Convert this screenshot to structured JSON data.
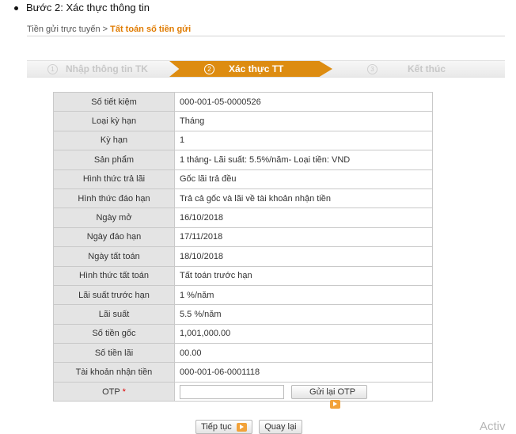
{
  "heading": {
    "step_text": "Bước 2: Xác thực  thông tin"
  },
  "breadcrumb": {
    "root": "Tiền gửi trực tuyến",
    "separator": " > ",
    "current": "Tất toán số tiền gửi"
  },
  "steps": [
    {
      "number": "1",
      "label": "Nhập thông tin TK",
      "state": "done"
    },
    {
      "number": "2",
      "label": "Xác thực TT",
      "state": "active"
    },
    {
      "number": "3",
      "label": "Kết thúc",
      "state": "pending"
    }
  ],
  "details": {
    "so_tiet_kiem": {
      "label": "Số tiết kiệm",
      "value": "000-001-05-0000526"
    },
    "loai_ky_han": {
      "label": "Loại kỳ hạn",
      "value": "Tháng"
    },
    "ky_han": {
      "label": "Kỳ hạn",
      "value": "1"
    },
    "san_pham": {
      "label": "Sản phẩm",
      "value": "1 tháng- Lãi suất: 5.5%/năm- Loại tiền: VND"
    },
    "hinh_thuc_tra_lai": {
      "label": "Hình thức trả lãi",
      "value": "Gốc lãi trả đều"
    },
    "hinh_thuc_dao_han": {
      "label": "Hình thức đáo hạn",
      "value": "Trả cả gốc và lãi về tài khoản nhận tiền"
    },
    "ngay_mo": {
      "label": "Ngày mở",
      "value": "16/10/2018"
    },
    "ngay_dao_han": {
      "label": "Ngày đáo hạn",
      "value": "17/11/2018"
    },
    "ngay_tat_toan": {
      "label": "Ngày tất toán",
      "value": "18/10/2018"
    },
    "hinh_thuc_tat_toan": {
      "label": "Hình thức tất toán",
      "value": "Tất toán trước hạn"
    },
    "lai_suat_truoc_han": {
      "label": "Lãi suất trước hạn",
      "value": "1 %/năm"
    },
    "lai_suat": {
      "label": "Lãi suất",
      "value": "5.5 %/năm"
    },
    "so_tien_goc": {
      "label": "Số tiền gốc",
      "value": "1,001,000.00"
    },
    "so_tien_lai": {
      "label": "Số tiền lãi",
      "value": "00.00"
    },
    "tai_khoan_nhan_tien": {
      "label": "Tài khoản nhận tiền",
      "value": "000-001-06-0001118"
    }
  },
  "otp": {
    "label": "OTP",
    "required_mark": "*",
    "value": "",
    "resend_label": "Gửi lại OTP"
  },
  "actions": {
    "continue_label": "Tiếp tục",
    "back_label": "Quay lại"
  },
  "watermark": "Activ",
  "colors": {
    "accent": "#dd8c11",
    "breadcrumb_current": "#e07b00",
    "label_bg": "#e4e4e4"
  }
}
